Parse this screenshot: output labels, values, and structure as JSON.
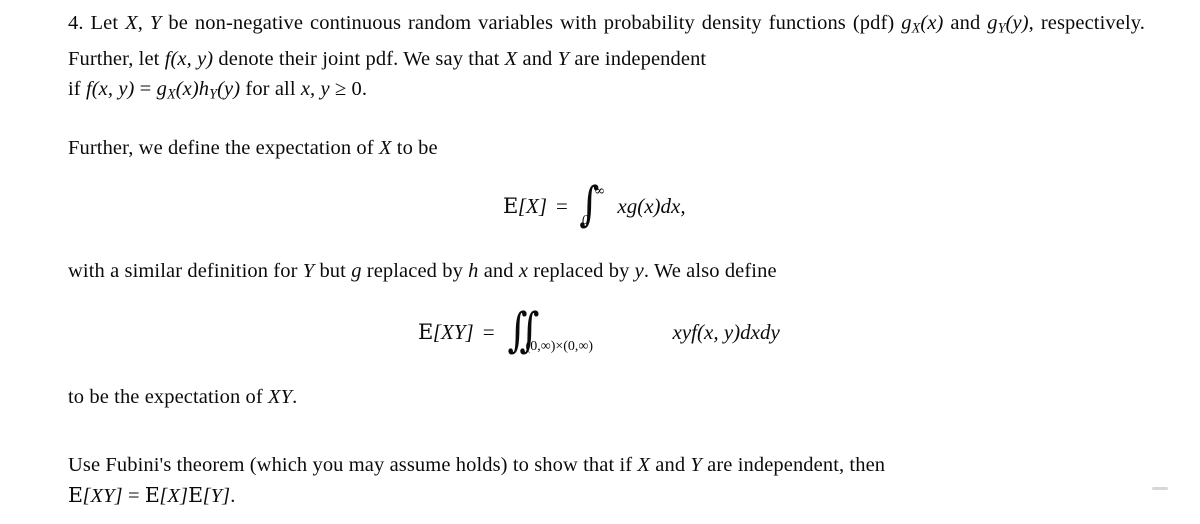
{
  "document": {
    "background_color": "#ffffff",
    "text_color": "#0b0b0b",
    "problem_number": "4.",
    "paragraphs": {
      "problem_statement": {
        "line1_a": "4. Let ",
        "line1_math_X": "X",
        "line1_comma": ", ",
        "line1_math_Y": "Y",
        "line1_b": " be non-negative continuous random variables with probability density functions (pdf) ",
        "line1_g_x": "g",
        "line1_g_x_sub": "X",
        "line1_g_x_arg": "(x)",
        "line2_a": "and ",
        "line2_g_y": "g",
        "line2_g_y_sub": "Y",
        "line2_g_y_arg": "(y)",
        "line2_b": ", respectively. Further, let ",
        "line2_f": "f(x, y)",
        "line2_c": " denote their joint pdf. We say that ",
        "line2_X": "X",
        "line2_d": " and ",
        "line2_Y": "Y",
        "line2_e": " are independent",
        "line3_a": "if ",
        "line3_f": "f(x, y)",
        "line3_eq": " = ",
        "line3_g": "g",
        "line3_g_sub": "X",
        "line3_g_arg": "(x)",
        "line3_h": "h",
        "line3_h_sub": "Y",
        "line3_h_arg": "(y)",
        "line3_b": " for all ",
        "line3_xy": "x, y",
        "line3_geq": " ≥ 0."
      },
      "further_definition": {
        "text_a": "Further, we define the expectation of ",
        "math_X": "X",
        "text_b": " to be"
      },
      "similar_definition": {
        "text_a": "with a similar definition for ",
        "math_Y": "Y",
        "text_b": " but ",
        "math_g": "g",
        "text_c": " replaced by ",
        "math_h": "h",
        "text_d": " and ",
        "math_x": "x",
        "text_e": " replaced by ",
        "math_y": "y",
        "text_f": ". We also define"
      },
      "to_be_expectation": {
        "text_a": "to be the expectation of ",
        "math_XY": "XY",
        "text_b": "."
      },
      "fubini_task": {
        "line1": "Use Fubini's theorem (which you may assume holds) to show that if ",
        "line1_X": "X",
        "line1_and": " and ",
        "line1_Y": "Y",
        "line1_end": " are independent, then",
        "line2_lhs_E": "E",
        "line2_lhs_arg": "[XY]",
        "line2_eq": " = ",
        "line2_rhs_E1": "E",
        "line2_rhs_arg1": "[X]",
        "line2_rhs_E2": "E",
        "line2_rhs_arg2": "[Y]",
        "line2_period": "."
      }
    },
    "equations": {
      "expectation_x": {
        "name": "expectation-of-X",
        "lhs_E": "E",
        "lhs_arg": "[X]",
        "equals": "=",
        "integral_symbol": "∫",
        "upper_limit": "∞",
        "lower_limit": "0",
        "integrand": "xg(x)dx,"
      },
      "expectation_xy": {
        "name": "expectation-of-XY",
        "lhs_E": "E",
        "lhs_arg": "[XY]",
        "equals": "=",
        "integral_symbol": "∫∫",
        "domain": "(0,∞)×(0,∞)",
        "integrand": "xyf(x, y)dxdy"
      }
    }
  }
}
